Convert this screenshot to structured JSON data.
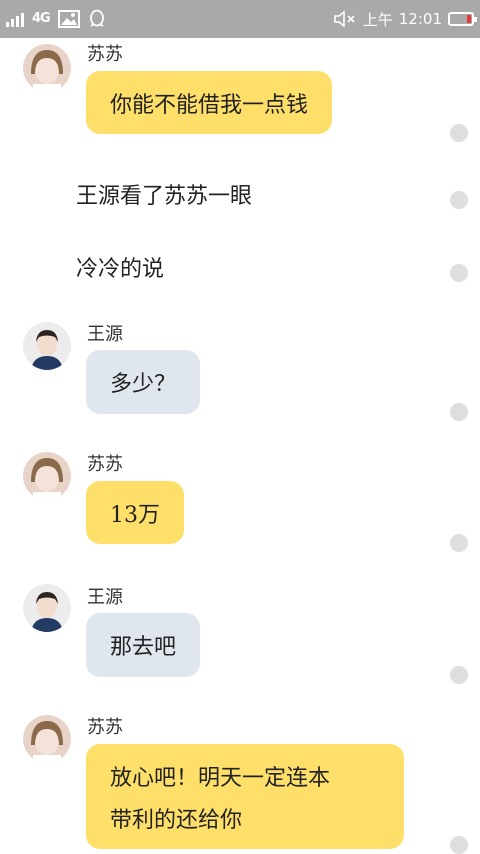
{
  "status": {
    "network": "4G",
    "time_prefix": "上午",
    "time": "12:01"
  },
  "messages": [
    {
      "type": "chat",
      "speaker": "苏苏",
      "side": "yellow",
      "text": "你能不能借我一点钱"
    },
    {
      "type": "narration",
      "text": "王源看了苏苏一眼"
    },
    {
      "type": "narration",
      "text": "冷冷的说"
    },
    {
      "type": "chat",
      "speaker": "王源",
      "side": "blue",
      "text": "多少？"
    },
    {
      "type": "chat",
      "speaker": "苏苏",
      "side": "yellow",
      "text": "13万"
    },
    {
      "type": "chat",
      "speaker": "王源",
      "side": "blue",
      "text": "那去吧"
    },
    {
      "type": "chat",
      "speaker": "苏苏",
      "side": "yellow",
      "lines": [
        "放心吧！明天一定连本",
        "带利的还给你"
      ]
    }
  ],
  "colors": {
    "status_bar": "#a9a9a9",
    "yellow_bubble": "#fedf6a",
    "blue_bubble": "#e0e6ee",
    "battery_low": "#e53935"
  }
}
